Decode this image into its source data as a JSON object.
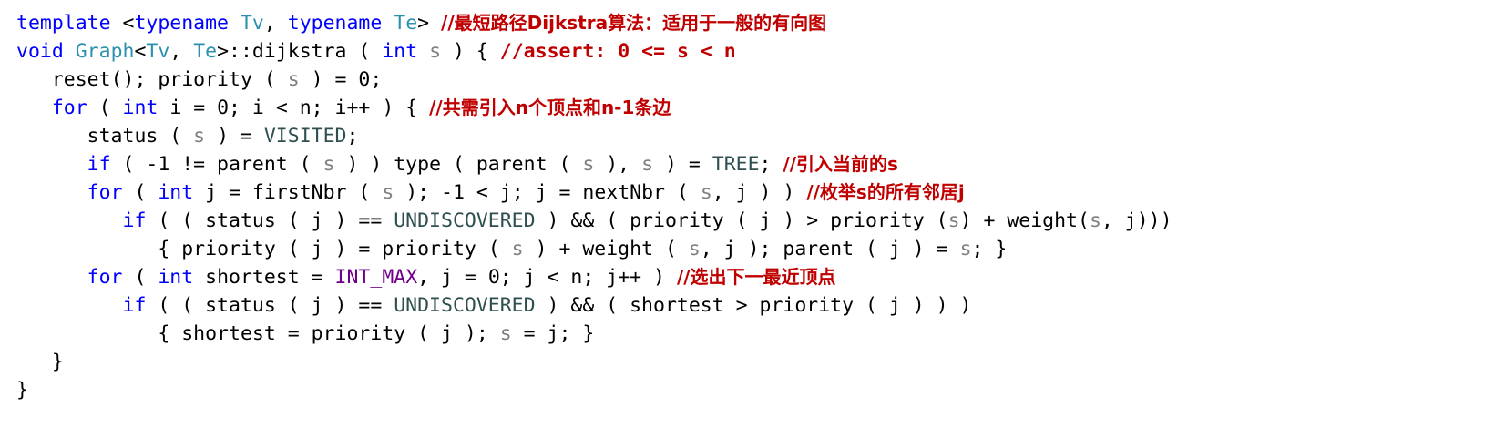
{
  "colors": {
    "keyword": "#0000ff",
    "type_param": "#2b91af",
    "parameter": "#808080",
    "enum_value": "#2f4f4f",
    "macro": "#6f008a",
    "comment": "#c00000",
    "text": "#000000"
  },
  "code": {
    "l1": {
      "kw_template": "template",
      "p1": " <",
      "kw_typename1": "typename",
      "sp1": " ",
      "ty_tv": "Tv",
      "p2": ", ",
      "kw_typename2": "typename",
      "sp2": " ",
      "ty_te": "Te",
      "p3": "> ",
      "comment": "//最短路径Dijkstra算法：适用于一般的有向图"
    },
    "l2": {
      "kw_void": "void",
      "sp": " ",
      "ty_graph": "Graph",
      "p1": "<",
      "ty_tv": "Tv",
      "p2": ", ",
      "ty_te": "Te",
      "p3": ">::dijkstra ( ",
      "kw_int": "int",
      "sp2": " ",
      "pa_s": "s",
      "p4": " ) { ",
      "comment": "//assert: 0 <= s < n"
    },
    "l3": {
      "indent": "   ",
      "p1": "reset(); priority ( ",
      "pa_s": "s",
      "p2": " ) = 0;"
    },
    "l4": {
      "indent": "   ",
      "kw_for": "for",
      "p1": " ( ",
      "kw_int": "int",
      "p2": " i = 0; i < n; i++ ) { ",
      "comment": "//共需引入n个顶点和n-1条边"
    },
    "l5": {
      "indent": "      ",
      "p1": "status ( ",
      "pa_s": "s",
      "p2": " ) = ",
      "en_visited": "VISITED",
      "p3": ";"
    },
    "l6": {
      "indent": "      ",
      "kw_if": "if",
      "p1": " ( -1 != parent ( ",
      "pa_s1": "s",
      "p2": " ) ) type ( parent ( ",
      "pa_s2": "s",
      "p3": " ), ",
      "pa_s3": "s",
      "p4": " ) = ",
      "en_tree": "TREE",
      "p5": "; ",
      "comment": "//引入当前的s"
    },
    "l7": {
      "indent": "      ",
      "kw_for": "for",
      "p1": " ( ",
      "kw_int": "int",
      "p2": " j = firstNbr ( ",
      "pa_s1": "s",
      "p3": " ); -1 < j; j = nextNbr ( ",
      "pa_s2": "s",
      "p4": ", j ) ) ",
      "comment": "//枚举s的所有邻居j"
    },
    "l8": {
      "indent": "         ",
      "kw_if": "if",
      "p1": " ( ( status ( j ) == ",
      "en_undiscovered": "UNDISCOVERED",
      "p2": " ) && ( priority ( j ) > priority (",
      "pa_s1": "s",
      "p3": ") + weight(",
      "pa_s2": "s",
      "p4": ", j)))"
    },
    "l9": {
      "indent": "            ",
      "p1": "{ priority ( j ) = priority ( ",
      "pa_s1": "s",
      "p2": " ) + weight ( ",
      "pa_s2": "s",
      "p3": ", j ); parent ( j ) = ",
      "pa_s3": "s",
      "p4": "; }"
    },
    "l10": {
      "indent": "      ",
      "kw_for": "for",
      "p1": " ( ",
      "kw_int": "int",
      "p2": " shortest = ",
      "ma_intmax": "INT_MAX",
      "p3": ", j = 0; j < n; j++ ) ",
      "comment": "//选出下一最近顶点"
    },
    "l11": {
      "indent": "         ",
      "kw_if": "if",
      "p1": " ( ( status ( j ) == ",
      "en_undiscovered": "UNDISCOVERED",
      "p2": " ) && ( shortest > priority ( j ) ) )"
    },
    "l12": {
      "indent": "            ",
      "p1": "{ shortest = priority ( j ); ",
      "pa_s": "s",
      "p2": " = j; }"
    },
    "l13": {
      "indent": "   ",
      "p1": "}"
    },
    "l14": {
      "p1": "}"
    }
  }
}
